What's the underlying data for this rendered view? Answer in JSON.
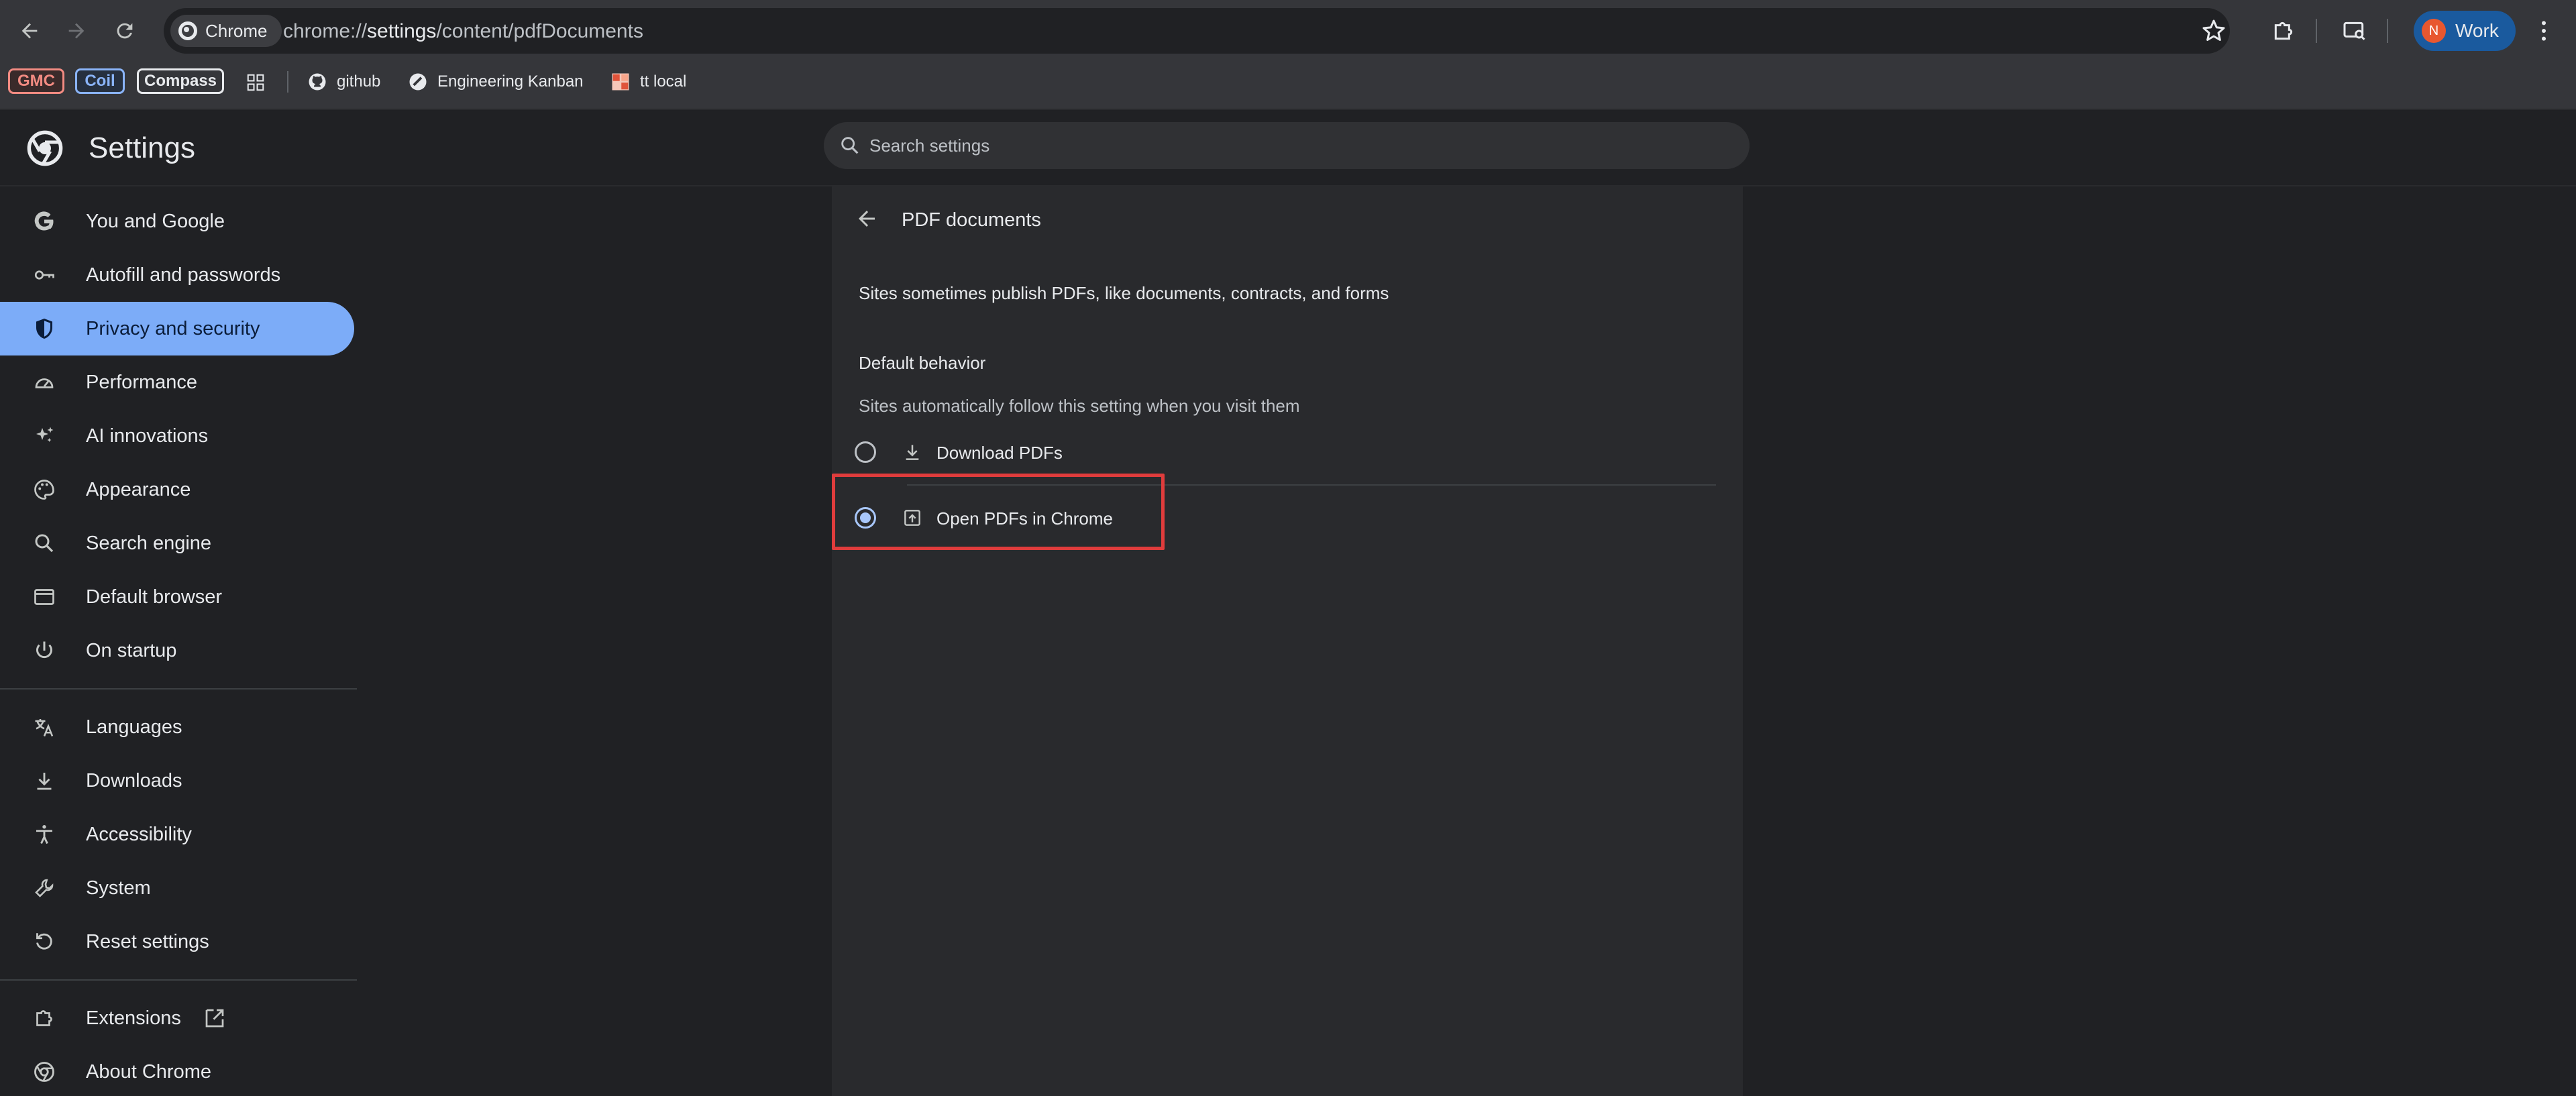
{
  "browser": {
    "omnibox": {
      "chip_label": "Chrome",
      "url_prefix": "chrome://",
      "url_host": "settings",
      "url_path": "/content/pdfDocuments"
    },
    "profile": {
      "initial": "N",
      "label": "Work"
    }
  },
  "bookmarks": {
    "pills": [
      {
        "label": "GMC",
        "color": "#f28b82"
      },
      {
        "label": "Coil",
        "color": "#8ab4f8"
      },
      {
        "label": "Compass",
        "color": "#e8eaed"
      }
    ],
    "items": [
      {
        "label": "github",
        "icon": "github-icon"
      },
      {
        "label": "Engineering Kanban",
        "icon": "kanban-icon"
      },
      {
        "label": "tt local",
        "icon": "tt-local-icon"
      }
    ]
  },
  "header": {
    "title": "Settings",
    "search_placeholder": "Search settings"
  },
  "sidebar": {
    "items": [
      {
        "label": "You and Google",
        "icon": "google-g-icon"
      },
      {
        "label": "Autofill and passwords",
        "icon": "key-icon"
      },
      {
        "label": "Privacy and security",
        "icon": "shield-icon",
        "active": true
      },
      {
        "label": "Performance",
        "icon": "speedometer-icon"
      },
      {
        "label": "AI innovations",
        "icon": "sparkle-icon"
      },
      {
        "label": "Appearance",
        "icon": "palette-icon"
      },
      {
        "label": "Search engine",
        "icon": "search-icon"
      },
      {
        "label": "Default browser",
        "icon": "browser-window-icon"
      },
      {
        "label": "On startup",
        "icon": "power-icon"
      },
      {
        "label": "Languages",
        "icon": "translate-icon"
      },
      {
        "label": "Downloads",
        "icon": "download-icon"
      },
      {
        "label": "Accessibility",
        "icon": "accessibility-icon"
      },
      {
        "label": "System",
        "icon": "wrench-icon"
      },
      {
        "label": "Reset settings",
        "icon": "reset-icon"
      },
      {
        "label": "Extensions",
        "icon": "puzzle-icon"
      },
      {
        "label": "About Chrome",
        "icon": "chrome-icon"
      }
    ]
  },
  "page": {
    "title": "PDF documents",
    "description": "Sites sometimes publish PDFs, like documents, contracts, and forms",
    "section_heading": "Default behavior",
    "section_subtext": "Sites automatically follow this setting when you visit them",
    "options": [
      {
        "label": "Download PDFs",
        "icon": "download-icon",
        "checked": false
      },
      {
        "label": "Open PDFs in Chrome",
        "icon": "open-in-new-icon",
        "checked": true
      }
    ]
  },
  "colors": {
    "accent": "#7cacf8",
    "highlight_box": "#e03c3c",
    "profile_bg": "#1a5a9e"
  }
}
